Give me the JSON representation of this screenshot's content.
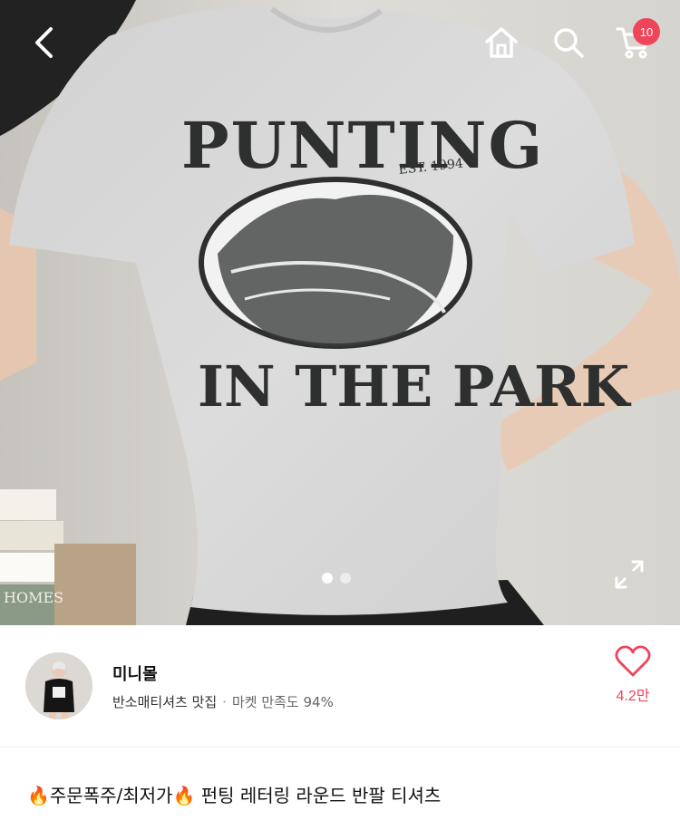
{
  "product_image": {
    "print_top": "PUNTING",
    "print_est": "EST. 1994",
    "print_bottom": "IN THE PARK",
    "book_spine": "HOMES",
    "page_dots": 2,
    "active_dot": 1
  },
  "topbar": {
    "back_icon": "chevron-left-icon",
    "home_icon": "home-icon",
    "search_icon": "search-icon",
    "cart_icon": "cart-icon",
    "cart_count": "10"
  },
  "seller": {
    "name": "미니몰",
    "tagline": "반소매티셔츠 맛집",
    "separator": "·",
    "satisfaction": "마켓 만족도 94%",
    "likes": "4.2만"
  },
  "product": {
    "title": "🔥주문폭주/최저가🔥 펀팅 레터링 라운드 반팔 티셔츠"
  },
  "colors": {
    "accent": "#f0445a"
  }
}
